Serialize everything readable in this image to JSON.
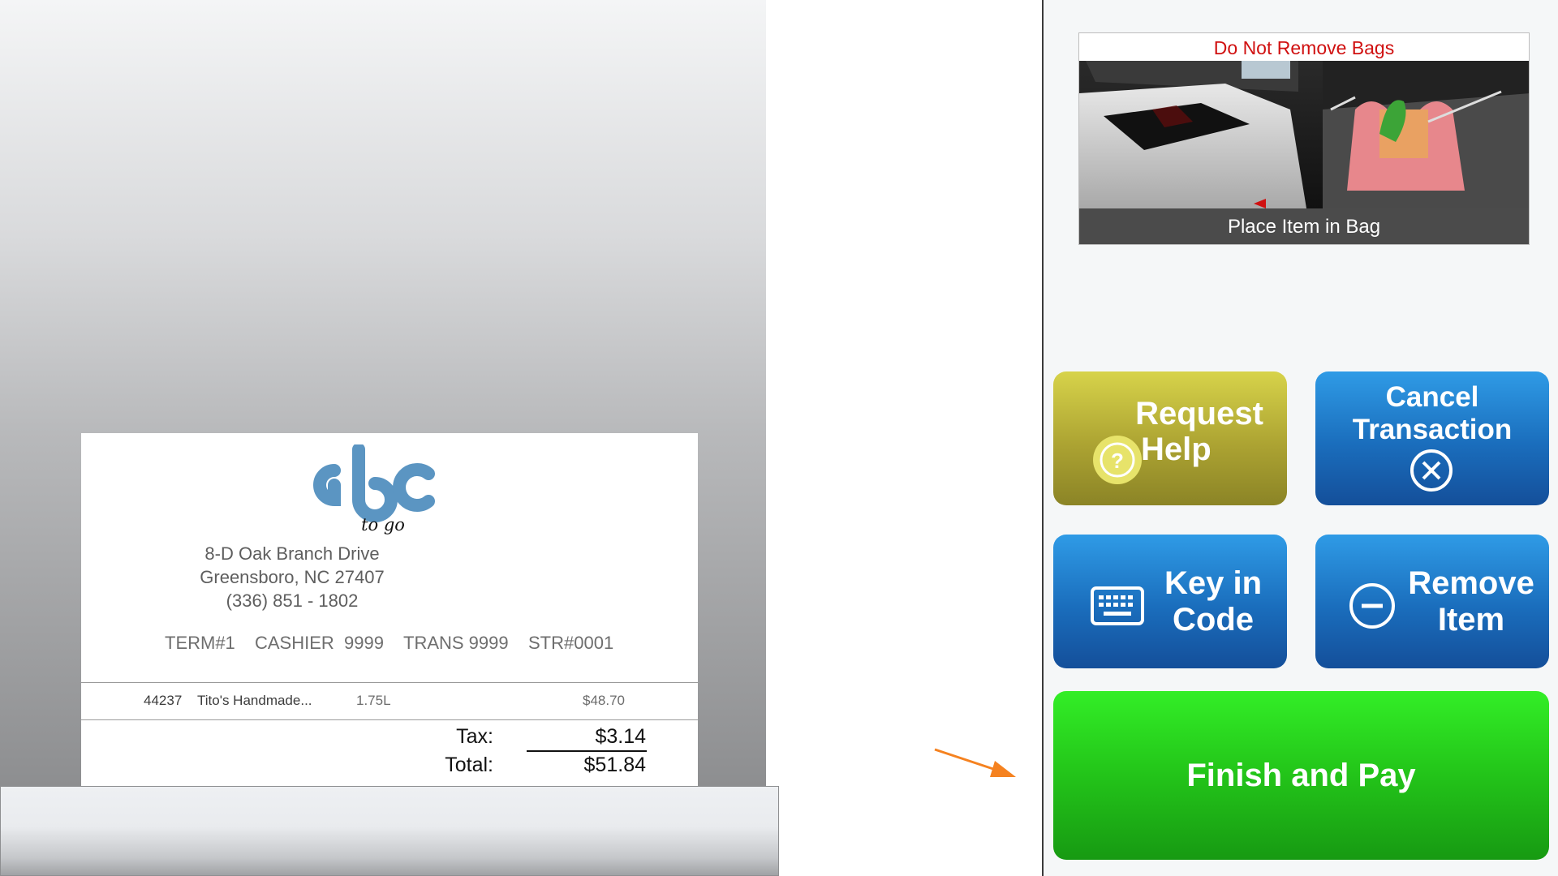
{
  "receipt": {
    "logo_text": "abc",
    "logo_subtext": "to go",
    "address_line1": "8-D  Oak Branch Drive",
    "address_line2": "Greensboro, NC 27407",
    "phone": "(336) 851 - 1802",
    "terminal": "TERM#1",
    "cashier": "CASHIER  9999",
    "transaction": "TRANS 9999",
    "store": "STR#0001",
    "items": [
      {
        "code": "44237",
        "name": "Tito's Handmade...",
        "size": "1.75L",
        "price": "$48.70"
      }
    ],
    "tax_label": "Tax:",
    "tax_value": "$3.14",
    "total_label": "Total:",
    "total_value": "$51.84"
  },
  "bagging": {
    "warning": "Do Not Remove Bags",
    "caption": "Place Item in Bag"
  },
  "buttons": {
    "help_line1": "Request",
    "help_line2": "Help",
    "cancel_line1": "Cancel",
    "cancel_line2": "Transaction",
    "keyin_line1": "Key in",
    "keyin_line2": "Code",
    "remove_line1": "Remove",
    "remove_line2": "Item",
    "finish": "Finish and Pay"
  },
  "colors": {
    "warning_red": "#d01010",
    "help_yellow": "#aca332",
    "action_blue": "#1a6dbc",
    "finish_green": "#24c81a",
    "arrow_orange": "#f58220",
    "logo_blue": "#5b95c2"
  },
  "icons": {
    "help": "question-circle-icon",
    "cancel": "x-circle-icon",
    "keyin": "keyboard-icon",
    "remove": "minus-circle-icon",
    "arrow": "arrow-right-icon"
  }
}
